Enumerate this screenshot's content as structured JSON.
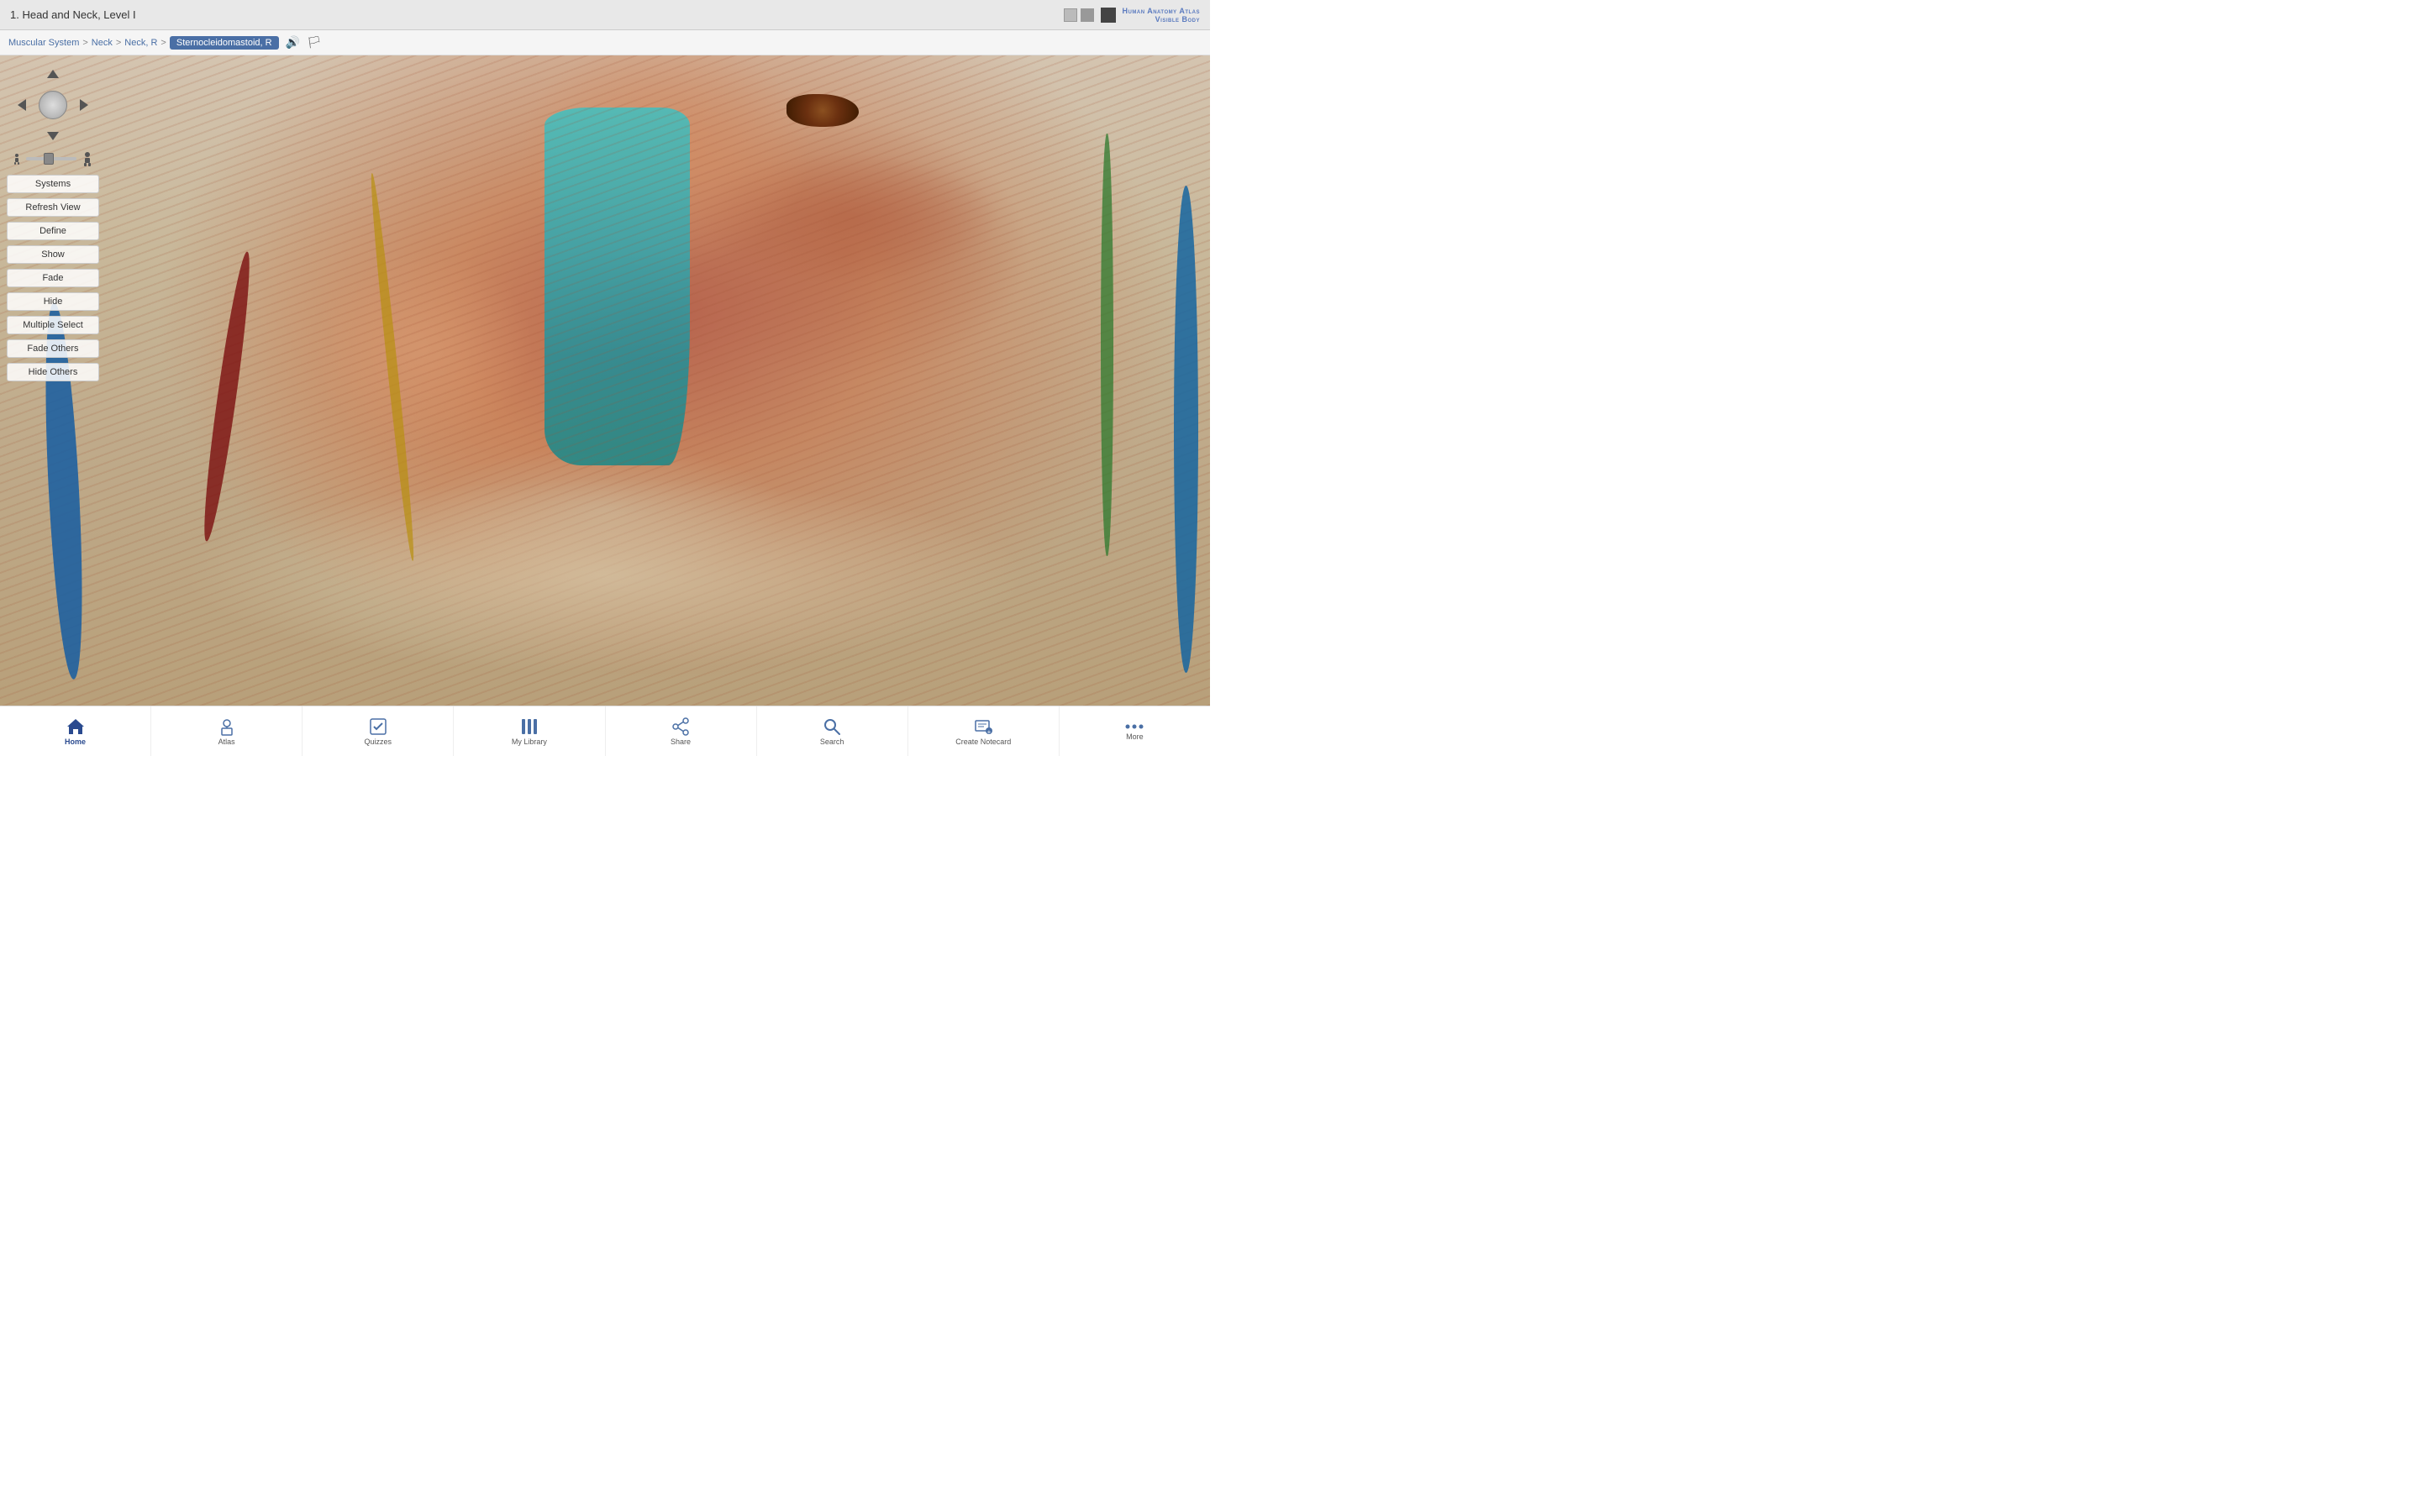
{
  "app": {
    "title": "Human Anatomy Atlas",
    "subtitle": "Visible Body"
  },
  "header": {
    "level_label": "1. Head and Neck, Level I"
  },
  "breadcrumb": {
    "items": [
      "Muscular System",
      "Neck",
      "Neck, R",
      "Sternocleidomastoid, R"
    ],
    "active_index": 3,
    "separators": [
      ">",
      ">",
      ">"
    ]
  },
  "controls": {
    "systems_label": "Systems",
    "refresh_label": "Refresh View",
    "define_label": "Define",
    "show_label": "Show",
    "fade_label": "Fade",
    "hide_label": "Hide",
    "multiple_select_label": "Multiple Select",
    "fade_others_label": "Fade Others",
    "hide_others_label": "Hide Others"
  },
  "bottom_nav": {
    "items": [
      {
        "id": "home",
        "label": "Home",
        "icon": "⌂"
      },
      {
        "id": "atlas",
        "label": "Atlas",
        "icon": "♟"
      },
      {
        "id": "quizzes",
        "label": "Quizzes",
        "icon": "☑"
      },
      {
        "id": "library",
        "label": "My Library",
        "icon": "▐▐▐"
      },
      {
        "id": "share",
        "label": "Share",
        "icon": "↗"
      },
      {
        "id": "search",
        "label": "Search",
        "icon": "🔍"
      },
      {
        "id": "notecard",
        "label": "Create Notecard",
        "icon": "✎"
      },
      {
        "id": "more",
        "label": "More",
        "icon": "•••"
      }
    ]
  },
  "icons": {
    "arrow_up": "▲",
    "arrow_down": "▼",
    "arrow_left": "◄",
    "arrow_right": "►",
    "sound": "🔊",
    "info": "ℹ",
    "window_min": "−",
    "window_max": "□",
    "window_close": "✕"
  }
}
